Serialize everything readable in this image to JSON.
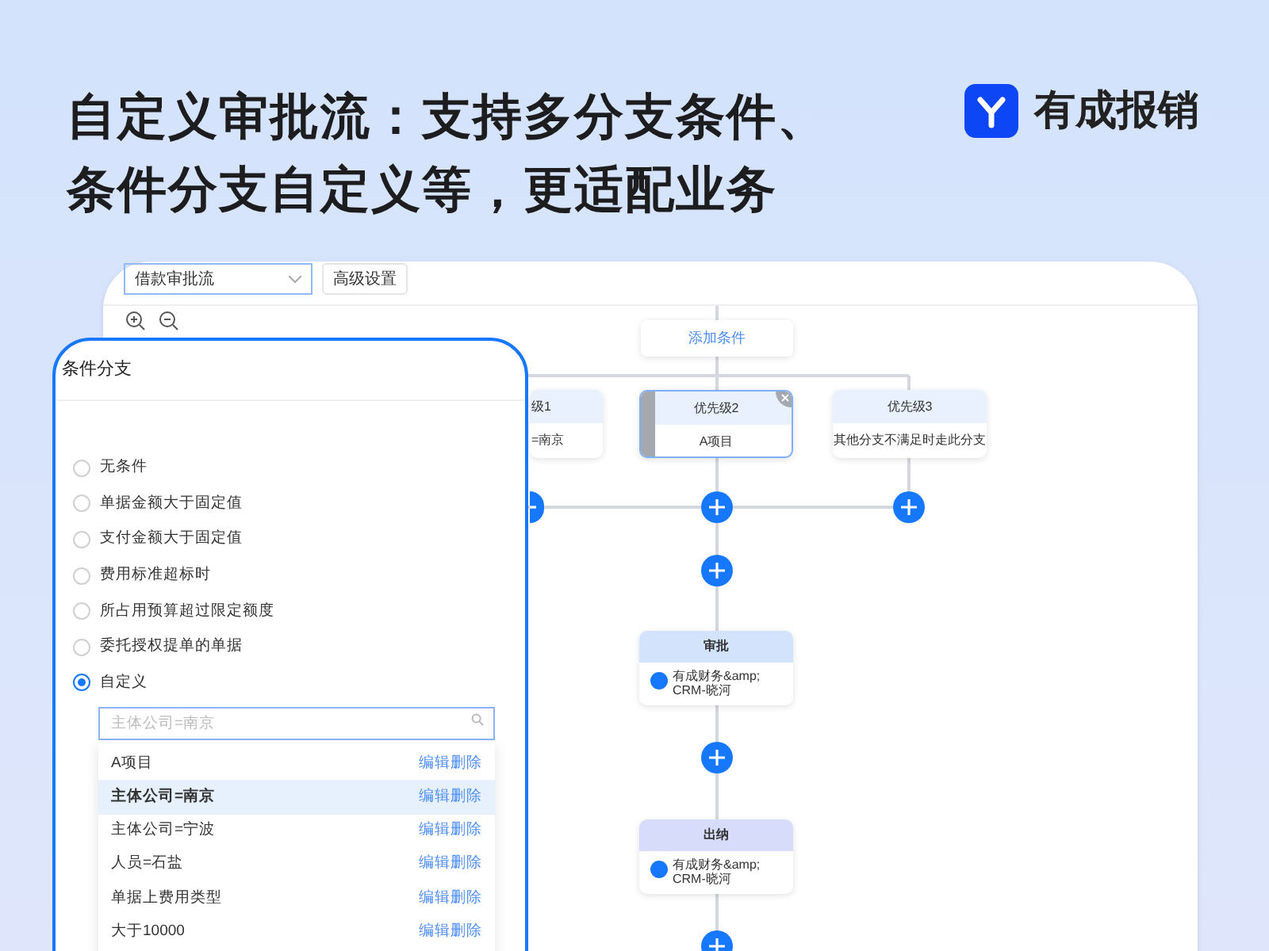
{
  "heading": {
    "lines": [
      "自定义审批流：支持多分支条件、",
      "条件分支自定义等，更适配业务"
    ]
  },
  "brand": {
    "name": "有成报销"
  },
  "toolbar": {
    "flow_select": {
      "value": "借款审批流"
    },
    "buttons": [
      "高级设置"
    ]
  },
  "canvas": {
    "add_condition": "添加条件",
    "branches": [
      {
        "title": "级1",
        "text": "=南京",
        "selected": false
      },
      {
        "title": "优先级2",
        "text": "A项目",
        "selected": true
      },
      {
        "title": "优先级3",
        "text": "其他分支不满足时走此分支",
        "selected": false
      }
    ],
    "nodes": [
      {
        "kind": "approval",
        "title": "审批",
        "assignee": "有成财务&amp;CRM-晓河"
      },
      {
        "kind": "cashier",
        "title": "出纳",
        "assignee": "有成财务&amp;CRM-晓河"
      }
    ]
  },
  "panel": {
    "title": "条件分支",
    "options": [
      {
        "label": "无条件",
        "selected": false
      },
      {
        "label": "单据金额大于固定值",
        "selected": false
      },
      {
        "label": "支付金额大于固定值",
        "selected": false
      },
      {
        "label": "费用标准超标时",
        "selected": false
      },
      {
        "label": "所占用预算超过限定额度",
        "selected": false
      },
      {
        "label": "委托授权提单的单据",
        "selected": false
      },
      {
        "label": "自定义",
        "selected": true
      }
    ],
    "search": {
      "placeholder": "主体公司=南京"
    },
    "conditions": [
      {
        "label": "A项目",
        "selected": false,
        "actions": [
          "编辑",
          "删除"
        ]
      },
      {
        "label": "主体公司=南京",
        "selected": true,
        "actions": [
          "编辑",
          "删除"
        ]
      },
      {
        "label": "主体公司=宁波",
        "selected": false,
        "actions": [
          "编辑",
          "删除"
        ]
      },
      {
        "label": "人员=石盐",
        "selected": false,
        "actions": [
          "编辑",
          "删除"
        ]
      },
      {
        "label": "单据上费用类型",
        "selected": false,
        "actions": [
          "编辑",
          "删除"
        ]
      },
      {
        "label": "大于10000",
        "selected": false,
        "actions": [
          "编辑",
          "删除"
        ]
      }
    ]
  }
}
